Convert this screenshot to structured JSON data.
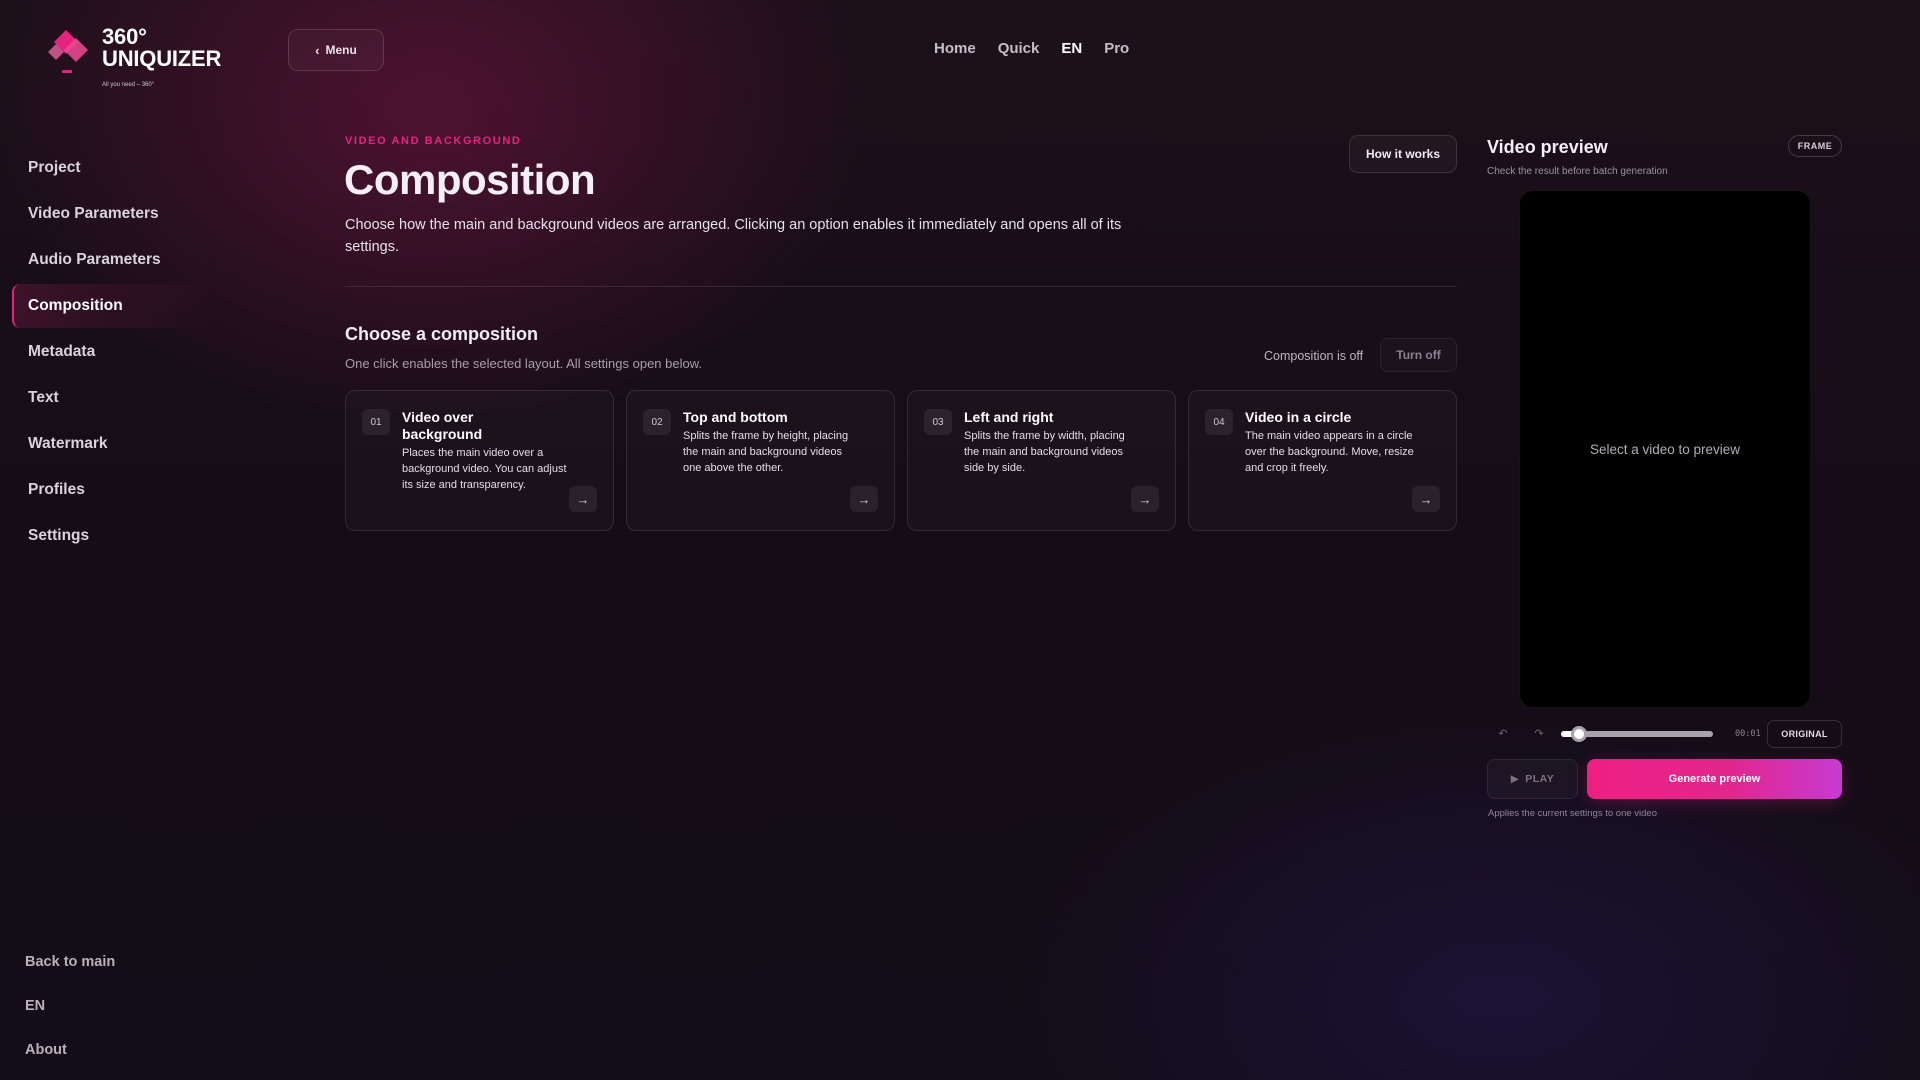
{
  "brand": {
    "name_line1": "360°",
    "name_line2": "UNIQUIZER",
    "tagline": "All you need – 360°",
    "accent_color": "#e5237f"
  },
  "header": {
    "menu_label": "Menu",
    "nav": [
      {
        "label": "Home",
        "active": false
      },
      {
        "label": "Quick",
        "active": false
      },
      {
        "label": "EN",
        "active": true
      },
      {
        "label": "Pro",
        "active": false
      }
    ]
  },
  "sidebar": {
    "items": [
      {
        "label": "Project"
      },
      {
        "label": "Video Parameters"
      },
      {
        "label": "Audio Parameters"
      },
      {
        "label": "Composition",
        "active": true
      },
      {
        "label": "Metadata"
      },
      {
        "label": "Text"
      },
      {
        "label": "Watermark"
      },
      {
        "label": "Profiles"
      },
      {
        "label": "Settings"
      }
    ],
    "bottom": [
      {
        "label": "Back to main"
      },
      {
        "label": "EN"
      },
      {
        "label": "About"
      }
    ]
  },
  "main": {
    "eyebrow": "VIDEO AND BACKGROUND",
    "title": "Composition",
    "description": "Choose how the main and background videos are arranged. Clicking an option enables it immediately and opens all of its settings.",
    "how_it_works": "How it works",
    "section_title": "Choose a composition",
    "section_sub": "One click enables the selected layout. All settings open below.",
    "status_text": "Composition is off",
    "turn_off_label": "Turn off",
    "cards": [
      {
        "num": "01",
        "title": "Video over background",
        "text": "Places the main video over a background video. You can adjust its size and transparency.",
        "arrow": "→"
      },
      {
        "num": "02",
        "title": "Top and bottom",
        "text": "Splits the frame by height, placing the main and background videos one above the other.",
        "arrow": "→"
      },
      {
        "num": "03",
        "title": "Left and right",
        "text": "Splits the frame by width, placing the main and background videos side by side.",
        "arrow": "→"
      },
      {
        "num": "04",
        "title": "Video in a circle",
        "text": "The main video appears in a circle over the background. Move, resize and crop it freely.",
        "arrow": "→"
      }
    ]
  },
  "preview": {
    "title": "Video preview",
    "subtitle": "Check the result before batch generation",
    "frame_badge": "FRAME",
    "placeholder": "Select a video to preview",
    "undo_icon": "undo-icon",
    "redo_icon": "redo-icon",
    "scrub_position": 0.12,
    "timecode": "00:01",
    "original_label": "ORIGINAL",
    "play_label": "PLAY",
    "generate_label": "Generate preview",
    "generate_note": "Applies the current settings to one video"
  }
}
